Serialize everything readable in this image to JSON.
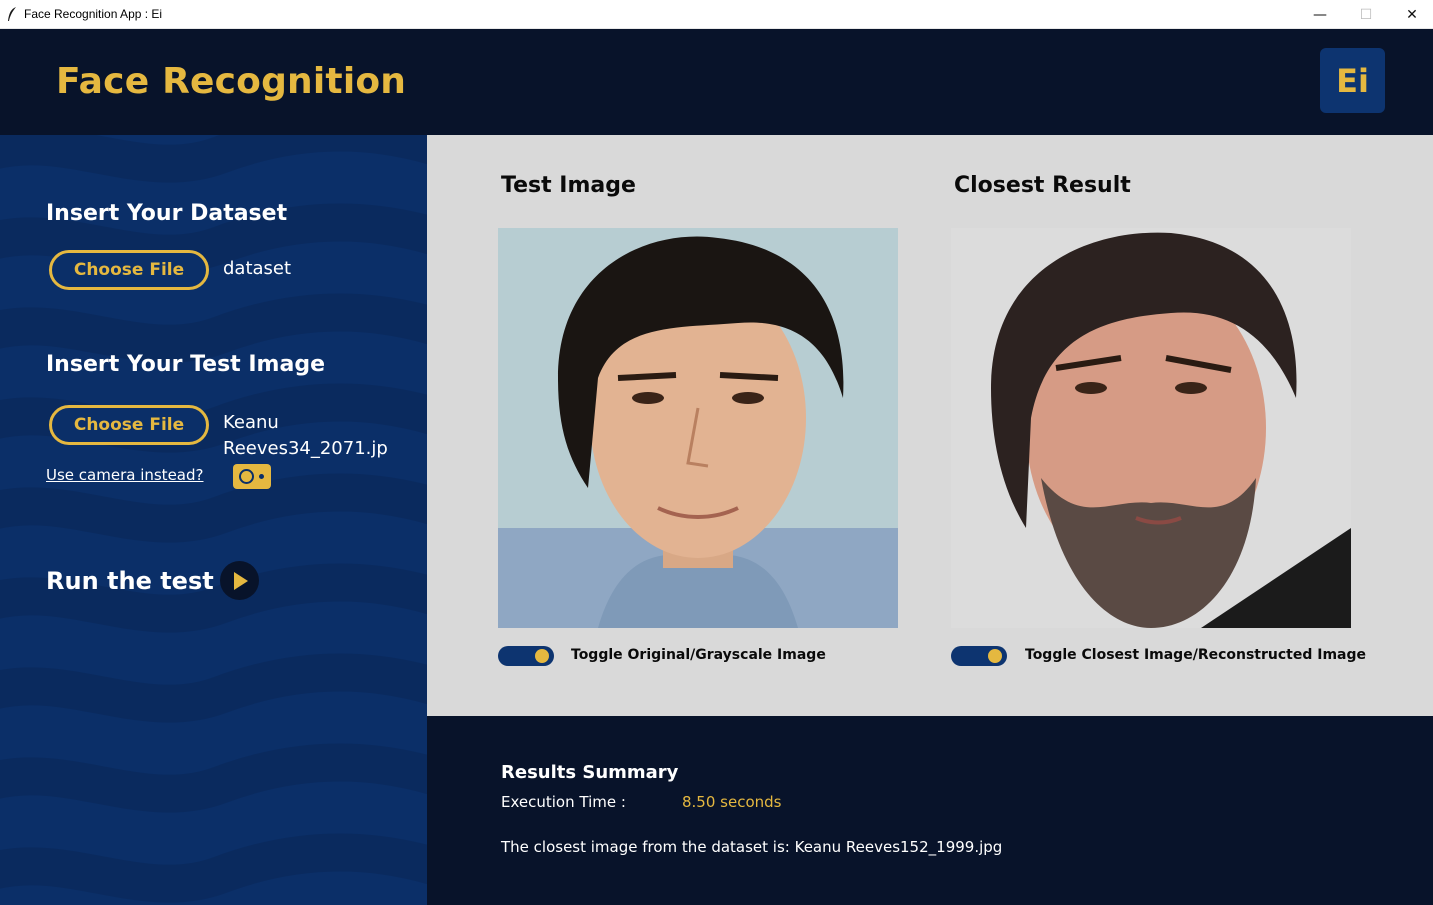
{
  "window": {
    "title": "Face Recognition App : Ei",
    "minimize_glyph": "—",
    "maximize_glyph": "☐",
    "close_glyph": "✕"
  },
  "header": {
    "title": "Face Recognition",
    "logo_text": "Ei"
  },
  "sidebar": {
    "dataset_heading": "Insert Your Dataset",
    "dataset_button": "Choose File",
    "dataset_value": "dataset",
    "test_heading": "Insert Your Test Image",
    "test_button": "Choose File",
    "test_value_line1": "Keanu",
    "test_value_line2": "Reeves34_2071.jp",
    "camera_link": "Use camera instead?",
    "run_label": "Run the test"
  },
  "main": {
    "test_heading": "Test Image",
    "result_heading": "Closest Result",
    "test_toggle_label": "Toggle Original/Grayscale Image",
    "result_toggle_label": "Toggle Closest Image/Reconstructed Image",
    "test_toggle_on": true,
    "result_toggle_on": true
  },
  "results": {
    "title": "Results Summary",
    "exec_label": "Execution Time :",
    "exec_value": "8.50 seconds",
    "closest_text": "The closest image from the dataset is: Keanu Reeves152_1999.jpg"
  },
  "colors": {
    "navy_dark": "#08132a",
    "navy_sidebar": "#0b2f68",
    "accent_gold": "#e5b840",
    "panel_gray": "#d9d9d9"
  },
  "icons": {
    "app": "feather-icon",
    "camera": "camera-icon",
    "run": "play-icon"
  }
}
